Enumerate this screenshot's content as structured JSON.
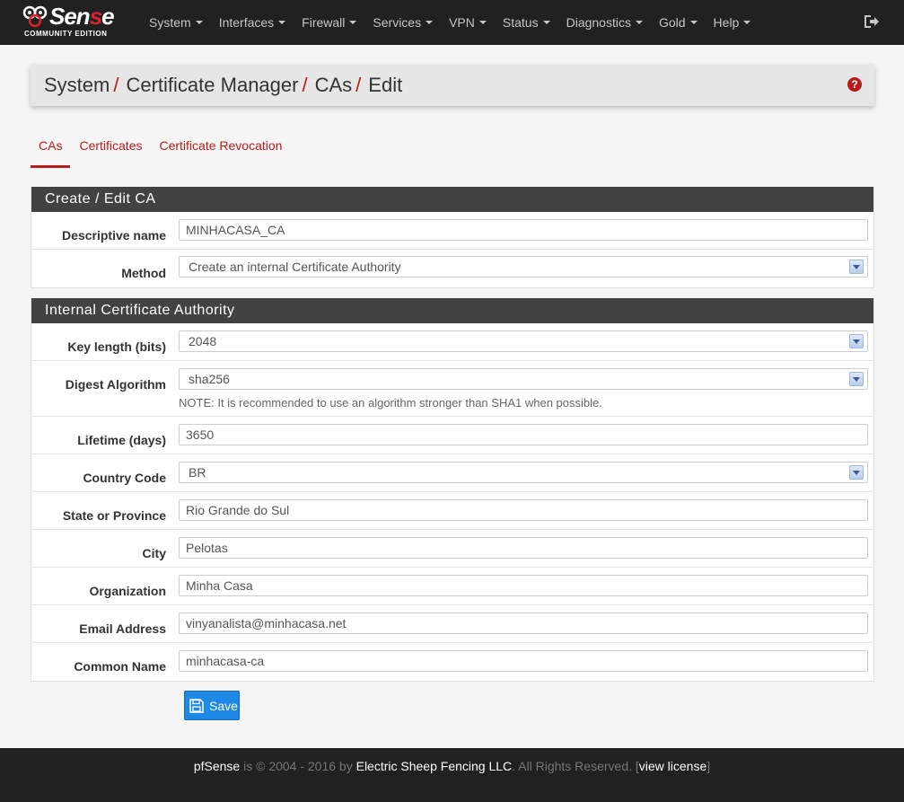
{
  "brand": {
    "name_pre": "Sen",
    "name_red": "s",
    "name_post": "e",
    "edition": "COMMUNITY EDITION"
  },
  "nav": {
    "items": [
      {
        "label": "System"
      },
      {
        "label": "Interfaces"
      },
      {
        "label": "Firewall"
      },
      {
        "label": "Services"
      },
      {
        "label": "VPN"
      },
      {
        "label": "Status"
      },
      {
        "label": "Diagnostics"
      },
      {
        "label": "Gold"
      },
      {
        "label": "Help"
      }
    ]
  },
  "breadcrumb": {
    "level1": "System",
    "level2": "Certificate Manager",
    "level3": "CAs",
    "level4": "Edit",
    "sep": "/"
  },
  "help_icon": "?",
  "tabs": [
    {
      "label": "CAs",
      "active": true
    },
    {
      "label": "Certificates",
      "active": false
    },
    {
      "label": "Certificate Revocation",
      "active": false
    }
  ],
  "panel1": {
    "title": "Create / Edit CA",
    "descriptive_name": {
      "label": "Descriptive name",
      "value": "MINHACASA_CA"
    },
    "method": {
      "label": "Method",
      "value": "Create an internal Certificate Authority"
    }
  },
  "panel2": {
    "title": "Internal Certificate Authority",
    "key_length": {
      "label": "Key length (bits)",
      "value": "2048"
    },
    "digest": {
      "label": "Digest Algorithm",
      "value": "sha256",
      "note": "NOTE: It is recommended to use an algorithm stronger than SHA1 when possible."
    },
    "lifetime": {
      "label": "Lifetime (days)",
      "value": "3650"
    },
    "country": {
      "label": "Country Code",
      "value": "BR"
    },
    "state": {
      "label": "State or Province",
      "value": "Rio Grande do Sul"
    },
    "city": {
      "label": "City",
      "value": "Pelotas"
    },
    "organization": {
      "label": "Organization",
      "value": "Minha Casa"
    },
    "email": {
      "label": "Email Address",
      "value": "vinyanalista@minhacasa.net"
    },
    "common_name": {
      "label": "Common Name",
      "value": "minhacasa-ca"
    }
  },
  "save_label": "Save",
  "footer": {
    "product": "pfSense",
    "copy": " is © 2004 - 2016 by ",
    "company": "Electric Sheep Fencing LLC",
    "rights": ". All Rights Reserved. [",
    "license": "view license",
    "close": "]"
  },
  "colors": {
    "accent": "#b71c1c",
    "navbar": "#212121",
    "panel_heading": "#424242",
    "button": "#1e88e5"
  }
}
